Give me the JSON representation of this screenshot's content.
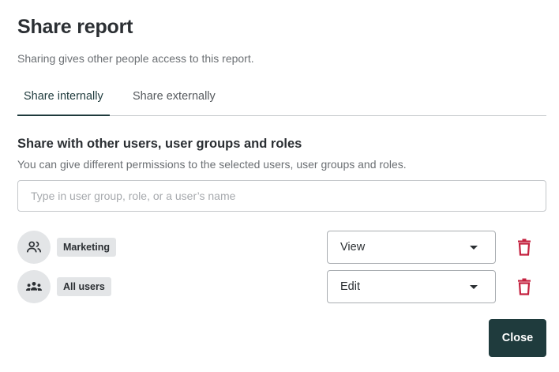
{
  "dialog": {
    "title": "Share report",
    "subtitle": "Sharing gives other people access to this report."
  },
  "tabs": [
    {
      "label": "Share internally",
      "active": true
    },
    {
      "label": "Share externally",
      "active": false
    }
  ],
  "share_section": {
    "title": "Share with other users, user groups and roles",
    "description": "You can give different permissions to the selected users, user groups and roles.",
    "search_placeholder": "Type in user group, role, or a user’s name"
  },
  "shares": [
    {
      "name": "Marketing",
      "icon": "users-icon",
      "permission": "View"
    },
    {
      "name": "All users",
      "icon": "users-group-icon",
      "permission": "Edit"
    }
  ],
  "footer": {
    "close_label": "Close"
  },
  "colors": {
    "primary": "#1f3b3d",
    "danger": "#c4213f",
    "chip_bg": "#e3e5e7",
    "border": "#c4c7ca"
  }
}
